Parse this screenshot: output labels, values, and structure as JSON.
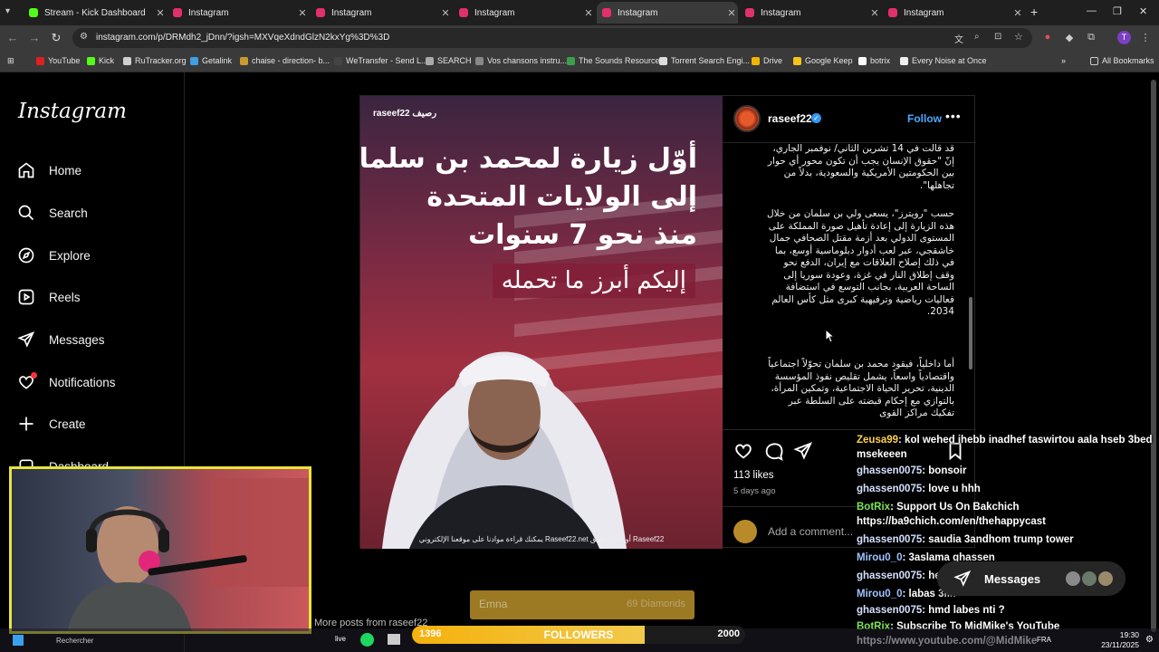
{
  "browser": {
    "tabs": [
      {
        "title": "Stream - Kick Dashboard",
        "color": "#53fc18"
      },
      {
        "title": "Instagram",
        "color": "#e1306c"
      },
      {
        "title": "Instagram",
        "color": "#e1306c"
      },
      {
        "title": "Instagram",
        "color": "#e1306c"
      },
      {
        "title": "Instagram",
        "color": "#e1306c"
      },
      {
        "title": "Instagram",
        "color": "#e1306c"
      },
      {
        "title": "Instagram",
        "color": "#e1306c"
      }
    ],
    "url": "instagram.com/p/DRMdh2_jDnn/?igsh=MXVqeXdndGlzN2kxYg%3D%3D",
    "bookmarks": [
      "YouTube",
      "Kick",
      "RuTracker.org",
      "Getalink",
      "chaise - direction- b...",
      "WeTransfer - Send L...",
      "SEARCH",
      "Vos chansons instru...",
      "The Sounds Resource",
      "Torrent Search Engi...",
      "Drive",
      "Google Keep",
      "botrix",
      "Every Noise at Once"
    ],
    "all_bookmarks": "All Bookmarks"
  },
  "instagram": {
    "logo": "Instagram",
    "nav": [
      "Home",
      "Search",
      "Explore",
      "Reels",
      "Messages",
      "Notifications",
      "Create",
      "Dashboard"
    ],
    "post": {
      "username": "raseef22",
      "follow": "Follow",
      "image_brand": "raseef22 رصيف",
      "image_headline": [
        "أوّل زيارة لمحمد بن سلمان",
        "إلى الولايات المتحدة",
        "منذ نحو 7 سنوات"
      ],
      "image_sub": "إليكم أبرز ما تحمله",
      "image_footer": "يمكنك قراءة موادنا على موقعنا الإلكتروني Raseef22.net أو على تطبيق Raseef22",
      "caption": [
        "قد قالت في 14 تشرين الثاني/ نوفمبر الجاري، إنّ \"حقوق الإنسان يجب أن تكون محور أي حوار بين الحكومتين الأمريكية والسعودية، بدلاً من تجاهلها\".",
        "حسب \"رويترز\"، يسعى ولي بن سلمان من خلال هذه الزيارة إلى إعادة تأهيل صورة المملكة على المستوى الدولي بعد أزمة مقتل الصحافي جمال خاشقجي، عبر لعب أدوار دبلوماسية أوسع، بما في ذلك إصلاح العلاقات مع إيران، الدفع نحو وقف إطلاق النار في غزة، وعودة سوريا إلى الساحة العربية، بجانب التوسع في استضافة فعاليات رياضية وترفيهية كبرى مثل كأس العالم 2034.",
        "أما داخلياً، فيقود محمد بن سلمان تحوّلاً اجتماعياً واقتصادياً واسعاً، يشمل تقليص نفوذ المؤسسة الدينية، تحرير الحياة الاجتماعية، وتمكين المرأة، بالتوازي مع إحكام قبضته على السلطة عبر تفكيك مراكز القوى"
      ],
      "likes": "113 likes",
      "posted": "5 days ago",
      "comment_placeholder": "Add a comment...",
      "more_posts": "More posts from raseef22"
    }
  },
  "stream": {
    "chat": [
      {
        "user": "Zeusa99",
        "text": ": kol wehed ihebb inadhef taswirtou aala hseb 3bed msekeeen",
        "kind": "z"
      },
      {
        "user": "ghassen0075",
        "text": ": bonsoir",
        "kind": "g"
      },
      {
        "user": "ghassen0075",
        "text": ": love u hhh",
        "kind": "g"
      },
      {
        "user": "BotRix",
        "text": ": Support Us On Bakchich https://ba9chich.com/en/thehappycast",
        "kind": "bot"
      },
      {
        "user": "ghassen0075",
        "text": ": saudia 3andhom trump tower",
        "kind": "g"
      },
      {
        "user": "Mirou0_0",
        "text": ": 3aslama ghassen",
        "kind": "m"
      },
      {
        "user": "ghassen0075",
        "text": ": hello",
        "kind": "g"
      },
      {
        "user": "Mirou0_0",
        "text": ": labas 3lik",
        "kind": "m"
      },
      {
        "user": "ghassen0075",
        "text": ": hmd labes nti ?",
        "kind": "g"
      },
      {
        "user": "BotRix",
        "text": ": Subscribe To MidMike's YouTube https://www.youtube.com/@MidMike",
        "kind": "bot"
      }
    ],
    "messages_label": "Messages",
    "donation": {
      "name": "Emna",
      "amount": "69 Diamonds"
    },
    "followers": {
      "current": "1396",
      "label": "FOLLOWERS",
      "goal": "2000",
      "progress": 0.698
    }
  },
  "taskbar": {
    "search": "Rechercher",
    "lang": "FRA",
    "time": "19:30",
    "date": "23/11/2025"
  }
}
